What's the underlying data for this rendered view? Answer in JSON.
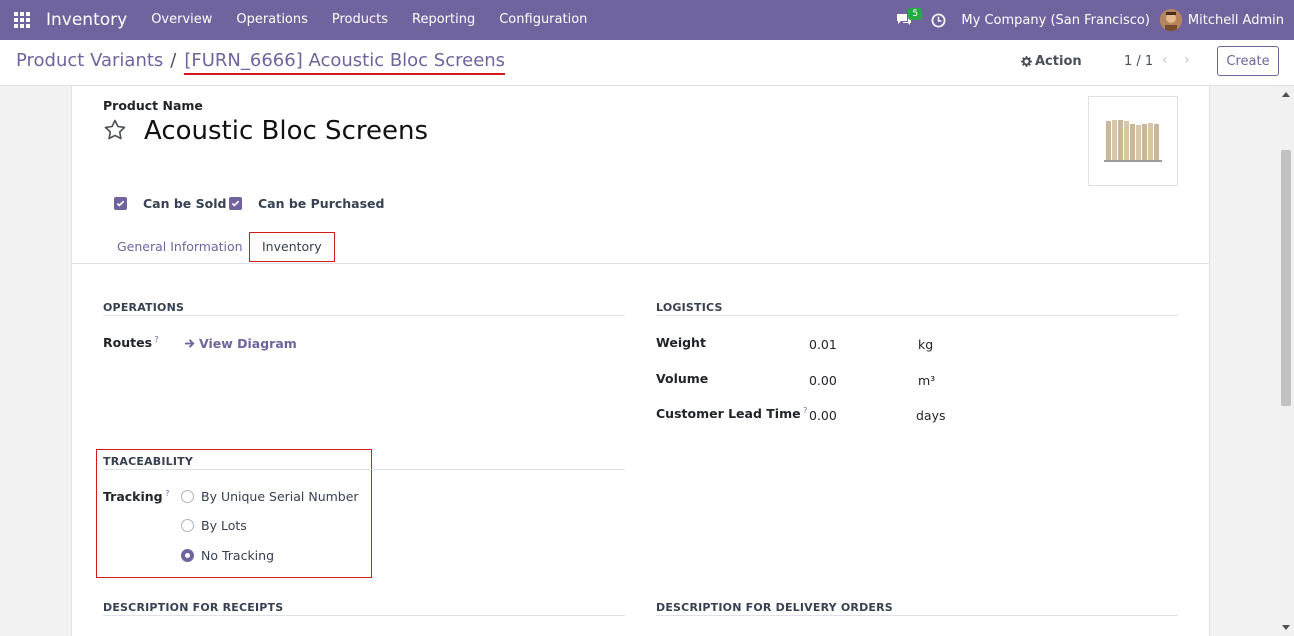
{
  "navbar": {
    "app_name": "Inventory",
    "menu": [
      "Overview",
      "Operations",
      "Products",
      "Reporting",
      "Configuration"
    ],
    "chat_count": "5",
    "company": "My Company (San Francisco)",
    "user": "Mitchell Admin"
  },
  "control": {
    "breadcrumb_parent": "Product Variants",
    "breadcrumb_sep": "/",
    "breadcrumb_current": "[FURN_6666] Acoustic Bloc Screens",
    "action_label": "Action",
    "pager": "1 / 1",
    "create_label": "Create"
  },
  "form": {
    "product_name_label": "Product Name",
    "product_name": "Acoustic Bloc Screens",
    "can_be_sold": "Can be Sold",
    "can_be_purchased": "Can be Purchased",
    "tabs": [
      "General Information",
      "Inventory"
    ],
    "operations": {
      "title": "OPERATIONS",
      "routes_label": "Routes",
      "view_diagram": "View Diagram"
    },
    "logistics": {
      "title": "LOGISTICS",
      "weight_label": "Weight",
      "weight_value": "0.01",
      "weight_unit": "kg",
      "volume_label": "Volume",
      "volume_value": "0.00",
      "volume_unit": "m³",
      "lead_time_label": "Customer Lead Time",
      "lead_time_value": "0.00",
      "lead_time_unit": "days"
    },
    "traceability": {
      "title": "TRACEABILITY",
      "tracking_label": "Tracking",
      "options": [
        "By Unique Serial Number",
        "By Lots",
        "No Tracking"
      ],
      "selected": "No Tracking"
    },
    "desc_receipts_title": "DESCRIPTION FOR RECEIPTS",
    "desc_delivery_title": "DESCRIPTION FOR DELIVERY ORDERS"
  },
  "colors": {
    "brand": "#71639e",
    "highlight": "#d11a1a",
    "badge": "#28a745"
  }
}
